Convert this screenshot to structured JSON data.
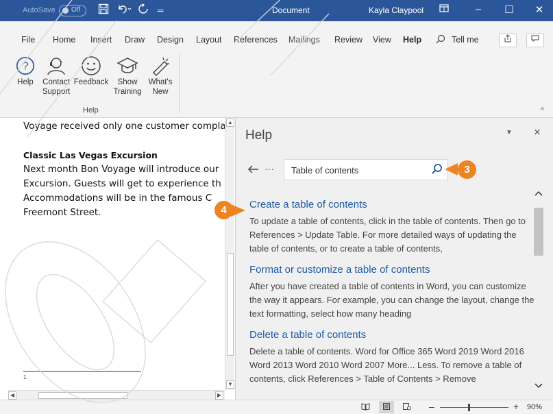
{
  "titlebar": {
    "autosave_label": "AutoSave",
    "autosave_state": "Off",
    "document_name": "Document",
    "user_name": "Kayla Claypool"
  },
  "tabs": [
    {
      "label": "File"
    },
    {
      "label": "Home"
    },
    {
      "label": "Insert"
    },
    {
      "label": "Draw"
    },
    {
      "label": "Design"
    },
    {
      "label": "Layout"
    },
    {
      "label": "References"
    },
    {
      "label": "Mailings"
    },
    {
      "label": "Review"
    },
    {
      "label": "View"
    },
    {
      "label": "Help"
    }
  ],
  "tell_me": "Tell me",
  "ribbon": {
    "buttons": [
      {
        "label": "Help",
        "icon": "help-icon"
      },
      {
        "label": "Contact Support",
        "icon": "contact-support-icon"
      },
      {
        "label": "Feedback",
        "icon": "feedback-icon"
      },
      {
        "label": "Show Training",
        "icon": "training-icon"
      },
      {
        "label": "What's New",
        "icon": "whats-new-icon"
      }
    ],
    "group_label": "Help"
  },
  "document": {
    "line1": "Voyage received only one customer compla",
    "heading": "Classic Las Vegas Excursion",
    "para": [
      "Next month Bon Voyage will introduce our",
      "Excursion. Guests will get to experience th",
      "Accommodations will be in the famous C",
      "Freemont Street."
    ],
    "footnote_number": "1"
  },
  "help_pane": {
    "title": "Help",
    "search_value": "Table of contents",
    "more": "···",
    "results": [
      {
        "title": "Create a table of contents",
        "description": "To update a table of contents, click in the table of contents. Then go to References > Update Table. For more detailed ways of updating the table of contents, or to create a table of contents,"
      },
      {
        "title": "Format or customize a table of contents",
        "description": "After you have created a table of contents in Word, you can customize the way it appears. For example, you can change the layout, change the text formatting, select how many heading"
      },
      {
        "title": "Delete a table of contents",
        "description": "Delete a table of contents. Word for Office 365 Word 2019 Word 2016 Word 2013 Word 2010 Word 2007 More... Less. To remove a table of contents, click References > Table of Contents > Remove"
      }
    ]
  },
  "callouts": {
    "step3": "3",
    "step4": "4"
  },
  "statusbar": {
    "zoom": "90%"
  },
  "colors": {
    "title_bar": "#2b579a",
    "link": "#1e5aa8",
    "callout": "#ee8322"
  }
}
